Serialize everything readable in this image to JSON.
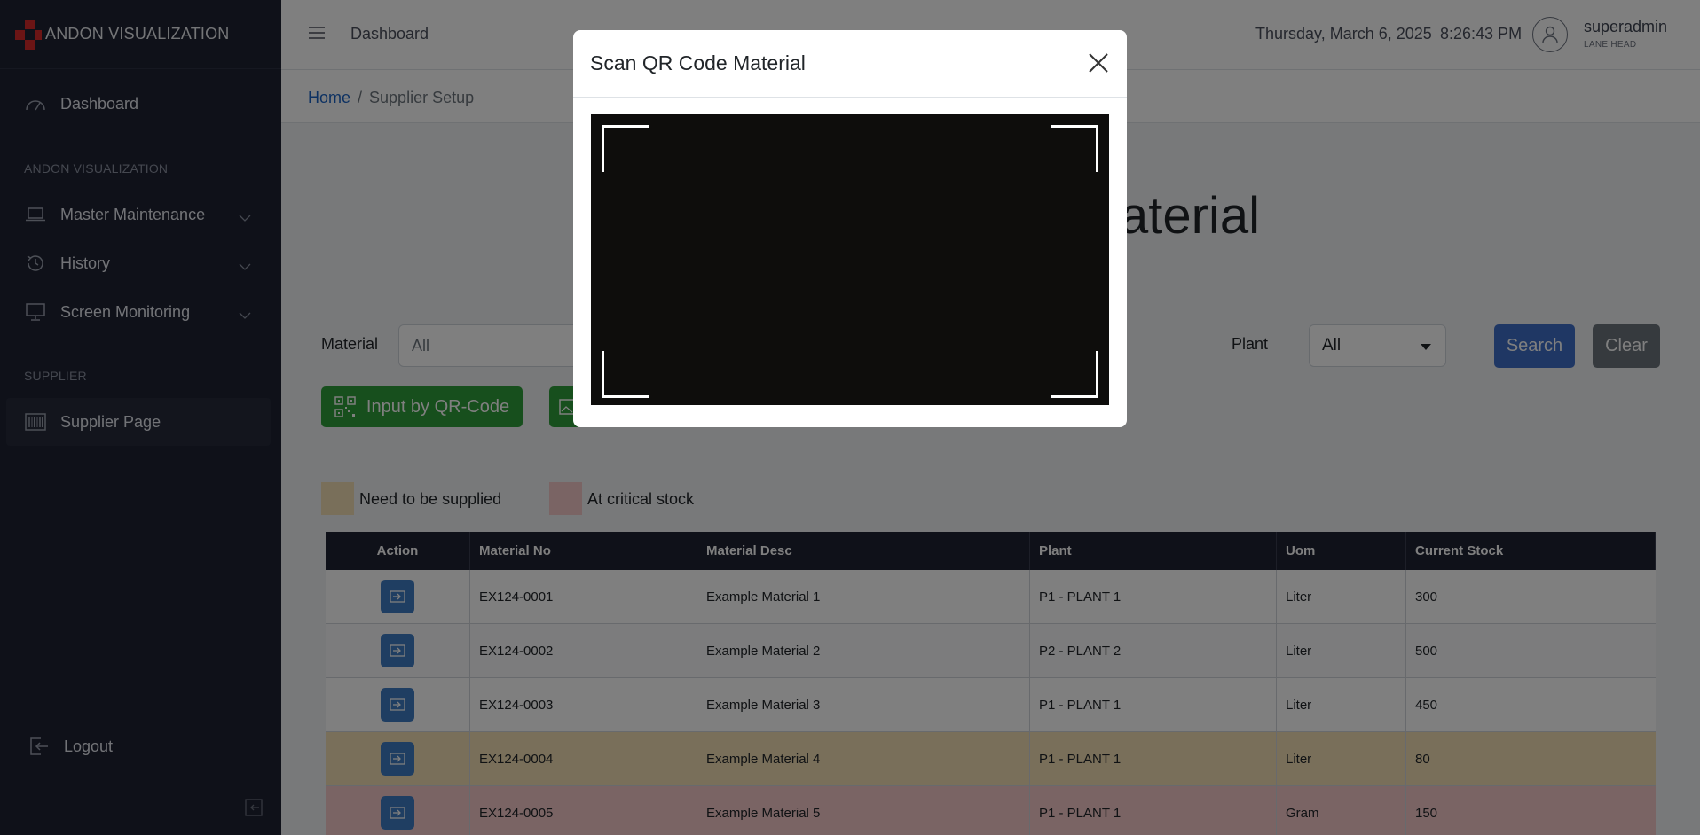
{
  "brand": {
    "name": "ANDON VISUALIZATION",
    "logo_color": "#d62b2b"
  },
  "sidebar": {
    "dashboard": "Dashboard",
    "section_andon": "ANDON VISUALIZATION",
    "master_maintenance": "Master Maintenance",
    "history": "History",
    "screen_monitoring": "Screen Monitoring",
    "section_supplier": "SUPPLIER",
    "supplier_page": "Supplier Page",
    "logout": "Logout"
  },
  "header": {
    "title": "Dashboard",
    "date": "Thursday, March 6, 2025",
    "time": "8:26:43 PM",
    "username": "superadmin",
    "role": "LANE HEAD"
  },
  "breadcrumb": {
    "home": "Home",
    "separator": "/",
    "current": "Supplier Setup"
  },
  "main": {
    "heading_fragment": "aterial",
    "material_label": "Material",
    "material_value": "All",
    "plant_label": "Plant",
    "plant_value": "All",
    "search_button": "Search",
    "clear_button": "Clear",
    "qr_button": "Input by QR-Code",
    "legend_supply": "Need to be supplied",
    "legend_critical": "At critical stock"
  },
  "colors": {
    "supply_row": "#f3deb4",
    "critical_row": "#f4c9c9",
    "accent_green": "#2e9e3a",
    "accent_blue": "#3e6ec8"
  },
  "table": {
    "headers": [
      "Action",
      "Material No",
      "Material Desc",
      "Plant",
      "Uom",
      "Current Stock"
    ],
    "rows": [
      {
        "no": "EX124-0001",
        "desc": "Example Material 1",
        "plant": "P1 - PLANT 1",
        "uom": "Liter",
        "stock": "300",
        "status": "normal"
      },
      {
        "no": "EX124-0002",
        "desc": "Example Material 2",
        "plant": "P2 - PLANT 2",
        "uom": "Liter",
        "stock": "500",
        "status": "normal"
      },
      {
        "no": "EX124-0003",
        "desc": "Example Material 3",
        "plant": "P1 - PLANT 1",
        "uom": "Liter",
        "stock": "450",
        "status": "normal"
      },
      {
        "no": "EX124-0004",
        "desc": "Example Material 4",
        "plant": "P1 - PLANT 1",
        "uom": "Liter",
        "stock": "80",
        "status": "supply"
      },
      {
        "no": "EX124-0005",
        "desc": "Example Material 5",
        "plant": "P1 - PLANT 1",
        "uom": "Gram",
        "stock": "150",
        "status": "critical"
      }
    ]
  },
  "modal": {
    "title": "Scan QR Code Material"
  }
}
